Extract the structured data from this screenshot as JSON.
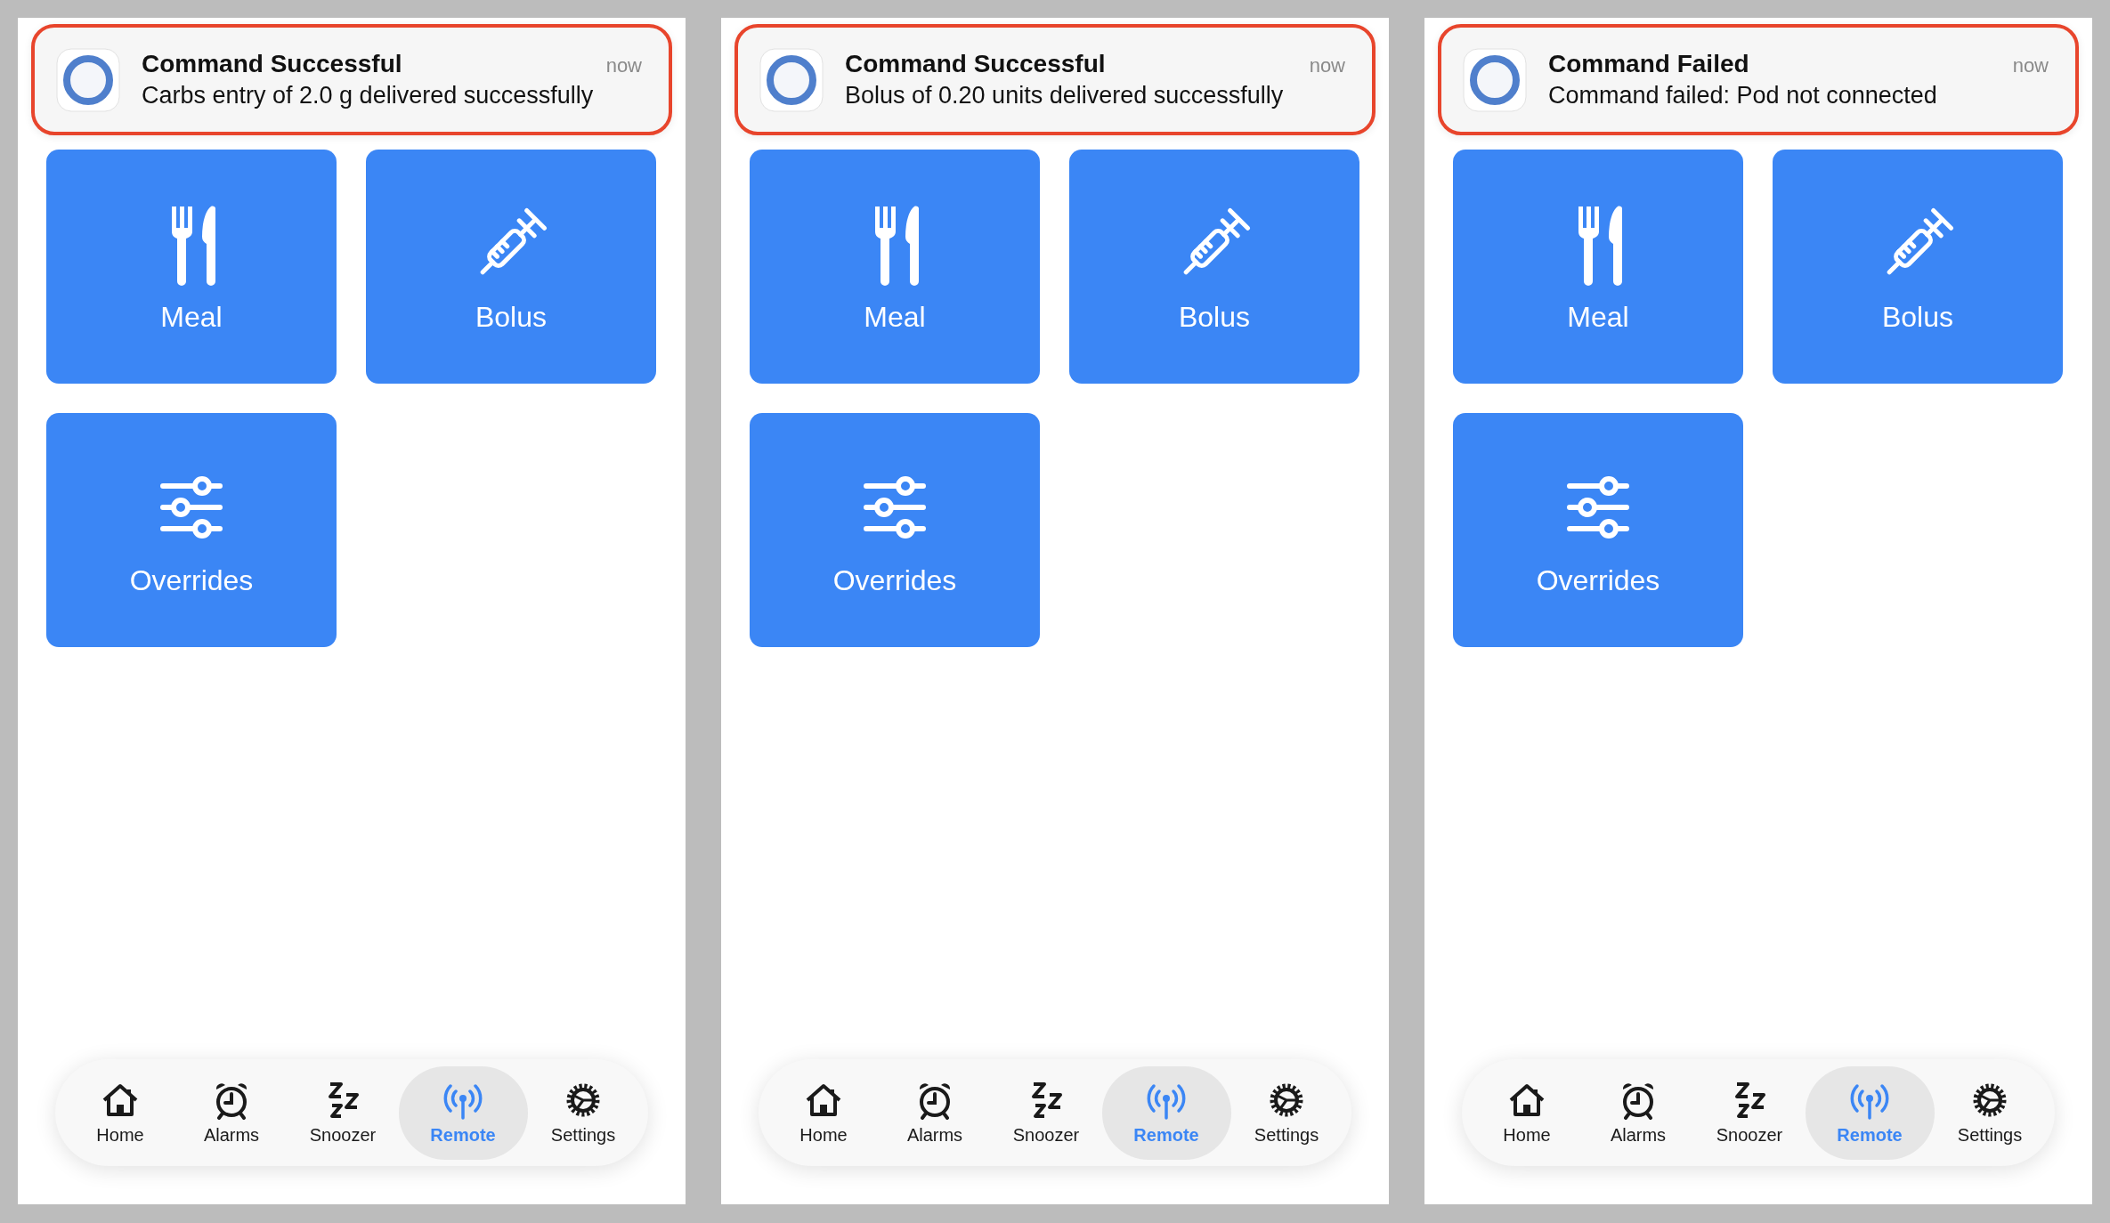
{
  "panels": [
    {
      "notification": {
        "title": "Command Successful",
        "body": "Carbs entry of 2.0 g delivered successfully",
        "time": "now",
        "highlighted": true
      },
      "tiles": [
        {
          "label": "Meal"
        },
        {
          "label": "Bolus"
        },
        {
          "label": "Overrides"
        }
      ],
      "tabs": [
        {
          "label": "Home",
          "selected": false
        },
        {
          "label": "Alarms",
          "selected": false
        },
        {
          "label": "Snoozer",
          "selected": false
        },
        {
          "label": "Remote",
          "selected": true
        },
        {
          "label": "Settings",
          "selected": false
        }
      ]
    },
    {
      "notification": {
        "title": "Command Successful",
        "body": "Bolus of 0.20 units delivered successfully",
        "time": "now",
        "highlighted": true
      },
      "tiles": [
        {
          "label": "Meal"
        },
        {
          "label": "Bolus"
        },
        {
          "label": "Overrides"
        }
      ],
      "tabs": [
        {
          "label": "Home",
          "selected": false
        },
        {
          "label": "Alarms",
          "selected": false
        },
        {
          "label": "Snoozer",
          "selected": false
        },
        {
          "label": "Remote",
          "selected": true
        },
        {
          "label": "Settings",
          "selected": false
        }
      ]
    },
    {
      "notification": {
        "title": "Command Failed",
        "body": "Command failed: Pod not connected",
        "time": "now",
        "highlighted": true
      },
      "tiles": [
        {
          "label": "Meal"
        },
        {
          "label": "Bolus"
        },
        {
          "label": "Overrides"
        }
      ],
      "tabs": [
        {
          "label": "Home",
          "selected": false
        },
        {
          "label": "Alarms",
          "selected": false
        },
        {
          "label": "Snoozer",
          "selected": false
        },
        {
          "label": "Remote",
          "selected": true
        },
        {
          "label": "Settings",
          "selected": false
        }
      ]
    }
  ]
}
